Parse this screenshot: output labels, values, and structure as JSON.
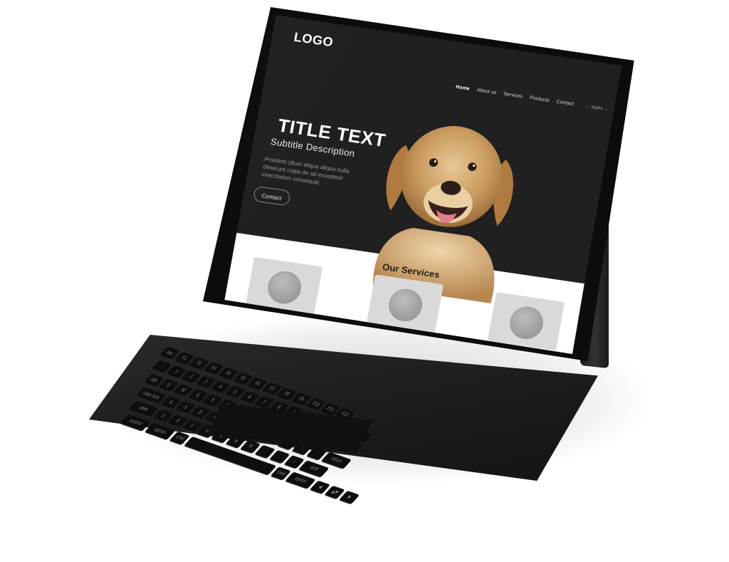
{
  "site": {
    "logo": "LOGO",
    "nav": [
      {
        "label": "Home",
        "active": true
      },
      {
        "label": "About us",
        "active": false
      },
      {
        "label": "Services",
        "active": false
      },
      {
        "label": "Products",
        "active": false
      },
      {
        "label": "Contact",
        "active": false
      }
    ],
    "language": "Inglés",
    "hero": {
      "title": "TITLE TEXT",
      "subtitle": "Subtitle Description",
      "description": "Proident cillum aliqua aliqua nulla deserunt culpa do ad excepteur exercitation consequat.",
      "button_label": "Contact"
    },
    "services": {
      "heading": "Our Services",
      "cards": 3
    }
  },
  "keyboard": {
    "rows": [
      [
        "esc",
        "F1",
        "F2",
        "F3",
        "F4",
        "F5",
        "F6",
        "F7",
        "F8",
        "F9",
        "F10",
        "F11",
        "F12"
      ],
      [
        "`",
        "1",
        "2",
        "3",
        "4",
        "5",
        "6",
        "7",
        "8",
        "9",
        "0",
        "-",
        "=",
        "delete"
      ],
      [
        "tab",
        "Q",
        "W",
        "E",
        "R",
        "T",
        "Y",
        "U",
        "I",
        "O",
        "P",
        "[",
        "]",
        "\\"
      ],
      [
        "caps lock",
        "A",
        "S",
        "D",
        "F",
        "G",
        "H",
        "J",
        "K",
        "L",
        ";",
        "'",
        "return"
      ],
      [
        "shift",
        "Z",
        "X",
        "C",
        "V",
        "B",
        "N",
        "M",
        ",",
        ".",
        "/",
        "shift"
      ],
      [
        "control",
        "option",
        "cmd",
        "",
        "cmd",
        "option",
        "◀",
        "▲▼",
        "▶"
      ]
    ]
  },
  "colors": {
    "hero_bg": "#202020",
    "device_body": "#0c0c0c",
    "page_bg": "#ffffff"
  }
}
